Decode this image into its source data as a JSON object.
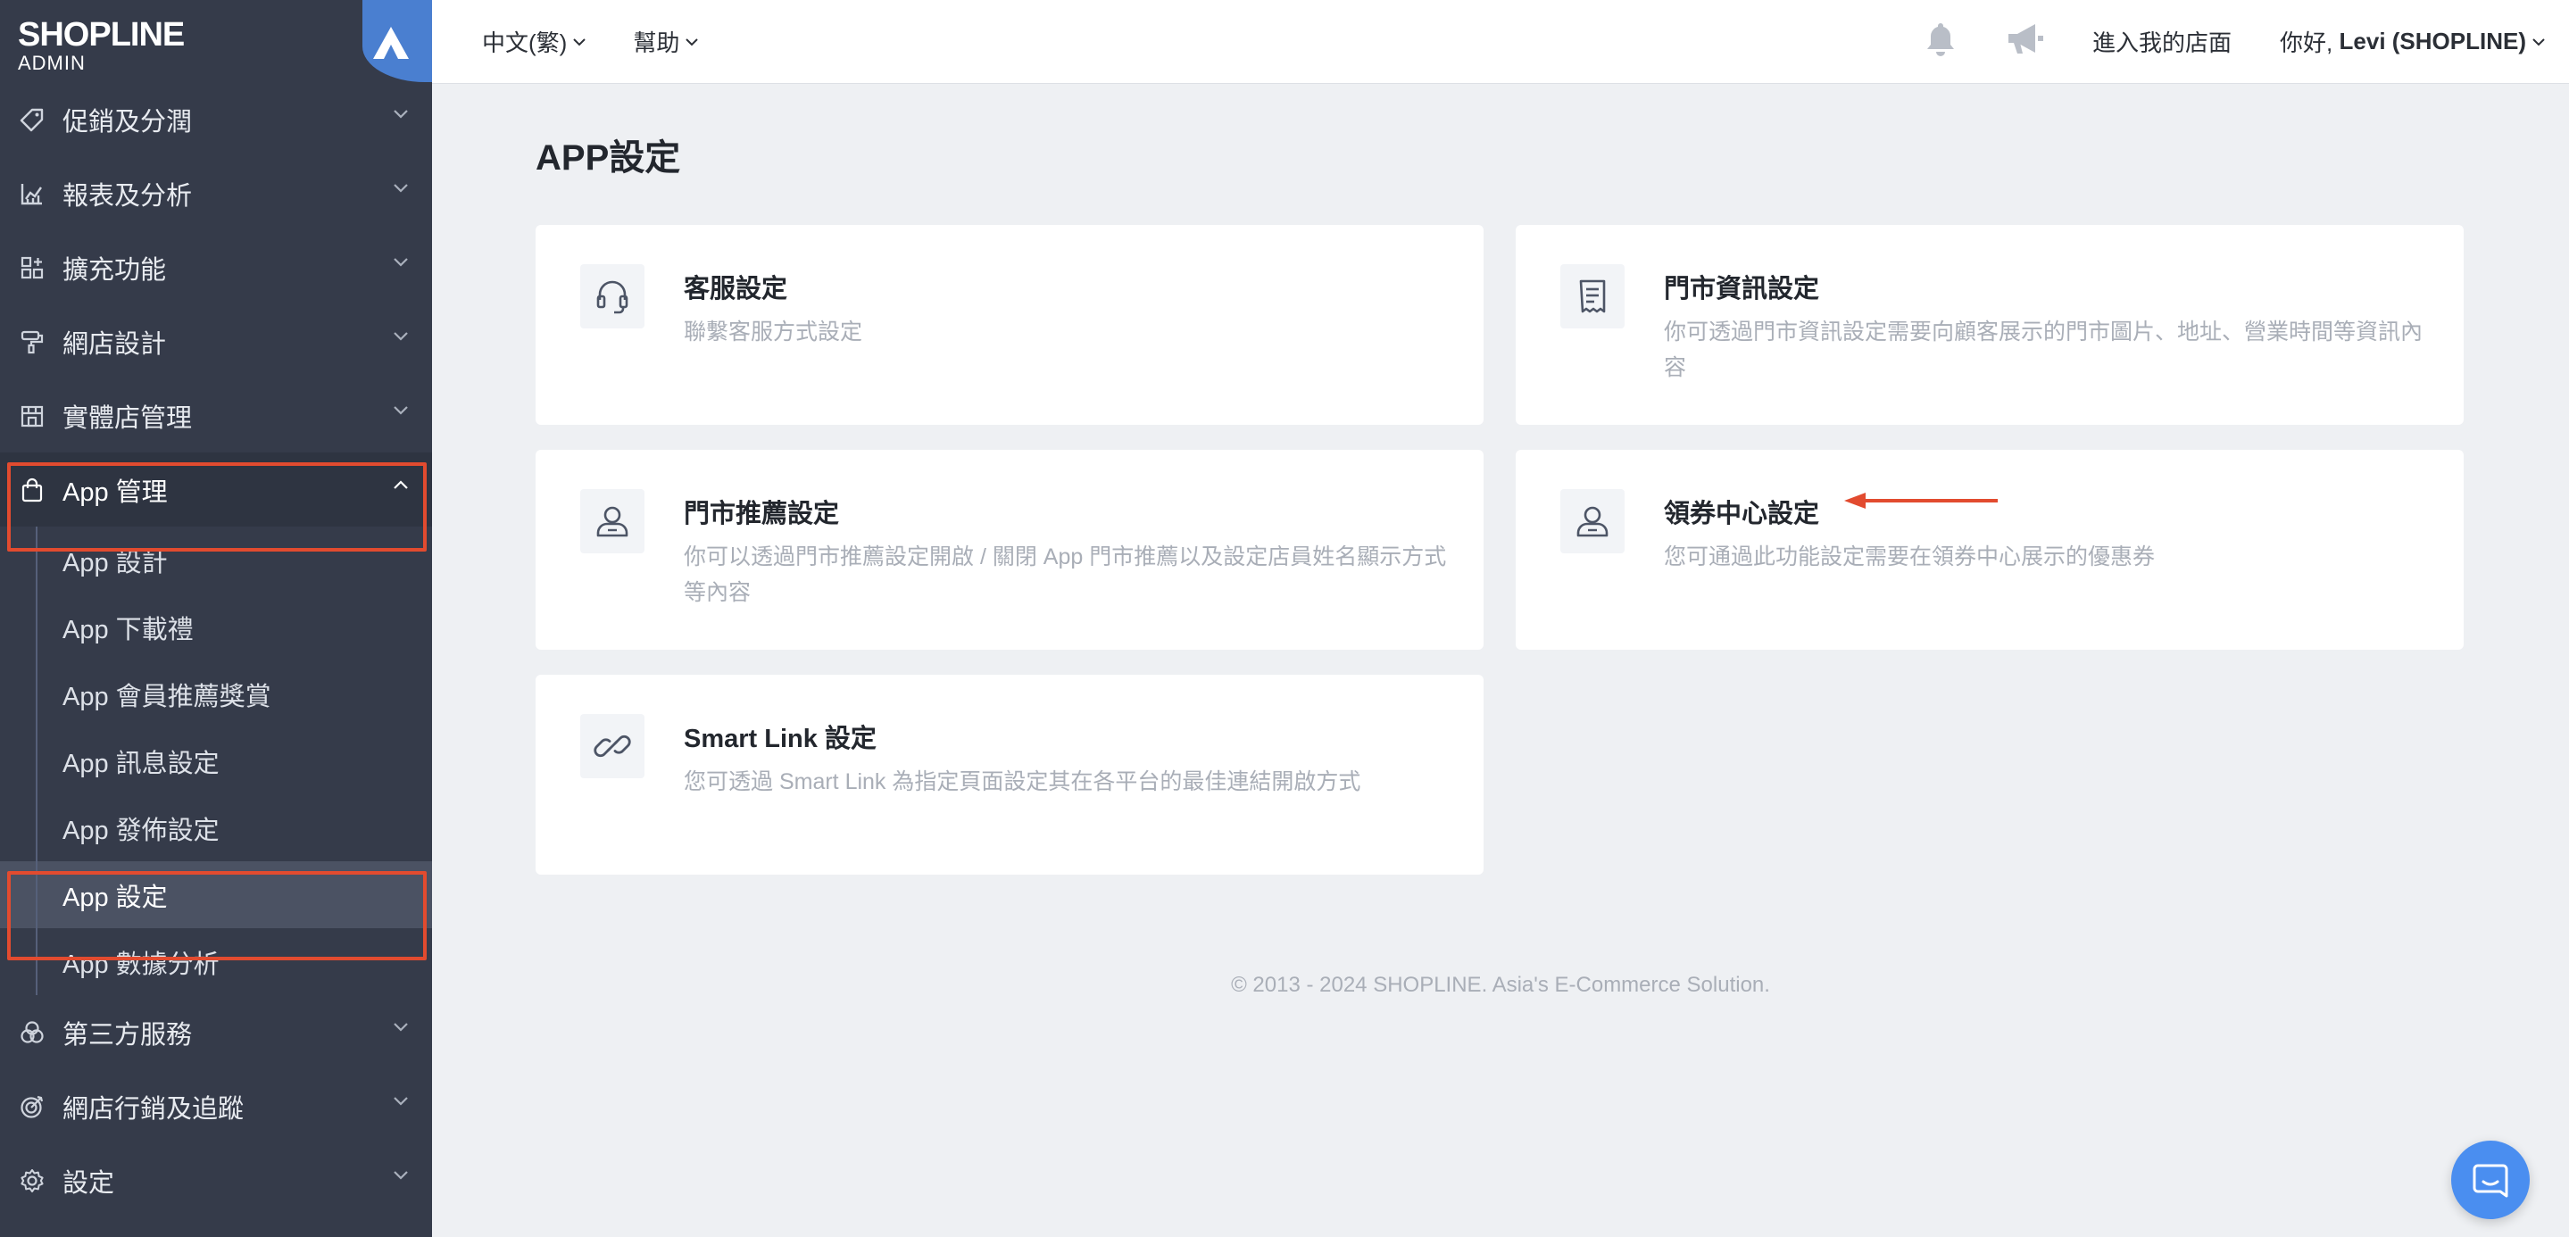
{
  "brand": {
    "logo_main": "SHOPLINE",
    "logo_sub": "ADMIN"
  },
  "sidebar": {
    "items": [
      {
        "label": "促銷及分潤",
        "icon": "tag-icon"
      },
      {
        "label": "報表及分析",
        "icon": "chart-icon"
      },
      {
        "label": "擴充功能",
        "icon": "apps-icon"
      },
      {
        "label": "網店設計",
        "icon": "paint-roller-icon"
      },
      {
        "label": "實體店管理",
        "icon": "store-icon"
      },
      {
        "label": "App 管理",
        "icon": "shopping-bag-icon",
        "expanded": true
      }
    ],
    "sub_items": [
      {
        "label": "App 設計"
      },
      {
        "label": "App 下載禮"
      },
      {
        "label": "App 會員推薦獎賞"
      },
      {
        "label": "App 訊息設定"
      },
      {
        "label": "App 發佈設定"
      },
      {
        "label": "App 設定",
        "active": true
      },
      {
        "label": "App 數據分析"
      }
    ],
    "bottom_items": [
      {
        "label": "第三方服務",
        "icon": "circles-icon"
      },
      {
        "label": "網店行銷及追蹤",
        "icon": "target-icon"
      },
      {
        "label": "設定",
        "icon": "gear-icon"
      }
    ]
  },
  "topbar": {
    "language": "中文(繁)",
    "help": "幫助",
    "store_link": "進入我的店面",
    "greeting": "你好,",
    "user_name": "Levi (SHOPLINE)"
  },
  "main": {
    "title": "APP設定",
    "cards": [
      {
        "title": "客服設定",
        "desc": "聯繫客服方式設定",
        "icon": "headset-icon"
      },
      {
        "title": "門市資訊設定",
        "desc": "你可透過門市資訊設定需要向顧客展示的門市圖片、地址、營業時間等資訊內容",
        "icon": "document-icon"
      },
      {
        "title": "門市推薦設定",
        "desc": "你可以透過門市推薦設定開啟 / 關閉 App 門市推薦以及設定店員姓名顯示方式等內容",
        "icon": "user-icon"
      },
      {
        "title": "領券中心設定",
        "desc": "您可通過此功能設定需要在領券中心展示的優惠券",
        "icon": "user-icon"
      },
      {
        "title": "Smart Link 設定",
        "desc": "您可透過 Smart Link 為指定頁面設定其在各平台的最佳連結開啟方式",
        "icon": "link-icon"
      }
    ],
    "footer": "© 2013 - 2024  SHOPLINE. Asia's E-Commerce Solution."
  },
  "colors": {
    "sidebar_bg": "#353b4a",
    "highlight": "#e24b2f",
    "accent": "#4a8ef0"
  }
}
